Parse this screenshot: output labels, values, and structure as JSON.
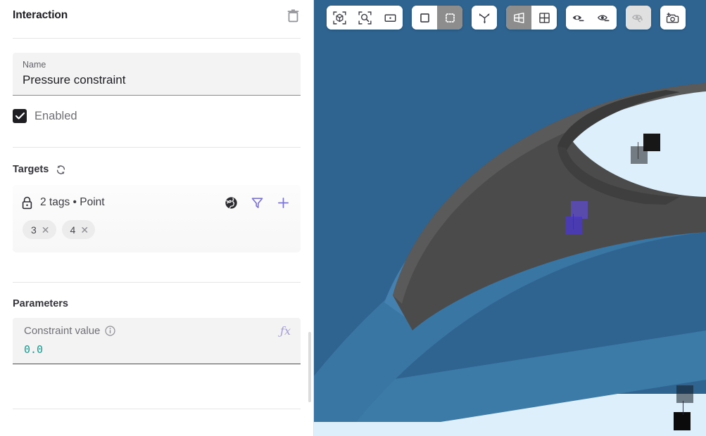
{
  "panel": {
    "title": "Interaction",
    "delete_icon": "trash-icon",
    "name_field": {
      "label": "Name",
      "value": "Pressure constraint"
    },
    "enabled": {
      "label": "Enabled",
      "checked": true,
      "check_glyph": "✓"
    },
    "targets": {
      "section_title": "Targets",
      "refresh_icon": "refresh-icon",
      "lock_icon": "lock-icon",
      "description": "2 tags • Point",
      "globe_icon": "globe-icon",
      "filter_icon": "filter-icon",
      "add_icon": "plus-icon",
      "chips": [
        {
          "label": "3",
          "remove": "✕"
        },
        {
          "label": "4",
          "remove": "✕"
        }
      ]
    },
    "parameters": {
      "section_title": "Parameters",
      "constraint": {
        "label": "Constraint value",
        "info_icon": "info-icon",
        "fx_label": "ƒx",
        "value": "0.0"
      }
    }
  },
  "viewport": {
    "toolbar": {
      "groups": [
        {
          "name": "framing-group",
          "buttons": [
            {
              "name": "fit-object-button",
              "icon": "cube-in-brackets-icon",
              "state": "normal"
            },
            {
              "name": "zoom-region-button",
              "icon": "magnifier-in-brackets-icon",
              "state": "normal"
            },
            {
              "name": "fit-selection-button",
              "icon": "rectangle-with-dot-icon",
              "state": "normal"
            }
          ]
        },
        {
          "name": "selection-group",
          "buttons": [
            {
              "name": "select-single-button",
              "icon": "solid-square-icon",
              "state": "normal"
            },
            {
              "name": "select-box-button",
              "icon": "dotted-square-icon",
              "state": "active"
            }
          ]
        },
        {
          "name": "axes-group",
          "buttons": [
            {
              "name": "axes-button",
              "icon": "axes-triad-icon",
              "state": "normal"
            }
          ]
        },
        {
          "name": "projection-group",
          "buttons": [
            {
              "name": "perspective-view-button",
              "icon": "perspective-grid-icon",
              "state": "active"
            },
            {
              "name": "orthographic-view-button",
              "icon": "orthographic-grid-icon",
              "state": "normal"
            }
          ]
        },
        {
          "name": "visibility-group",
          "buttons": [
            {
              "name": "hide-selected-button",
              "icon": "eye-solid-minus-icon",
              "state": "normal"
            },
            {
              "name": "show-selected-button",
              "icon": "eye-outline-minus-icon",
              "state": "normal"
            }
          ]
        },
        {
          "name": "reset-visibility-group",
          "buttons": [
            {
              "name": "reset-visibility-button",
              "icon": "eye-refresh-icon",
              "state": "disabled"
            }
          ]
        },
        {
          "name": "camera-group",
          "buttons": [
            {
              "name": "add-camera-button",
              "icon": "camera-plus-icon",
              "state": "normal"
            }
          ]
        }
      ]
    },
    "colors": {
      "background": "#2f6490",
      "disc_top": "#4b4b4b",
      "disc_side_blue": "#3c7aa8",
      "inner_hole": "#dceffb",
      "marker_purple": "#5b4bc4",
      "marker_dark": "#171717"
    },
    "markers": [
      {
        "name": "point-marker-dark-upper",
        "color": "dark"
      },
      {
        "name": "point-marker-purple",
        "color": "purple"
      },
      {
        "name": "point-marker-dark-lower",
        "color": "dark"
      }
    ]
  }
}
